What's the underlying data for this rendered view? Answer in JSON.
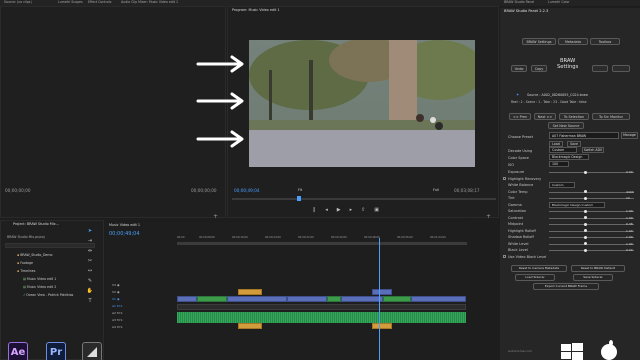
{
  "topbar": {
    "items": [
      "Source: (no clips)",
      "Lumetri Scopes",
      "Effect Controls",
      "Audio Clip Mixer: Music Video edit 1"
    ],
    "right": [
      "BRAW Studio Panel",
      "Lumetri Color"
    ]
  },
  "source": {
    "tc_left": "00;00;00;00",
    "tc_right": "00;00;00;00"
  },
  "program": {
    "tab": "Program: Music Video edit 1",
    "tc_left": "00;00;49;04",
    "fit": "Fit",
    "full": "Full",
    "tc_right": "00;03;08;17"
  },
  "braw": {
    "title": "BRAW Studio Panel 2.2.3",
    "tabs": [
      "BRAW Settings",
      "Metadata",
      "Toolbox"
    ],
    "toolbar": [
      "Undo",
      "Copy",
      "",
      ""
    ],
    "heading": "BRAW\nSettings",
    "source_line": "Source : A002_08260655_C024.braw",
    "meta_line": "Reel : 2 - Scene : 1 - Take : 23 - Good Take : false",
    "nav_buttons": [
      "<< Prev",
      "Next >>",
      "To Selection",
      "To Src Monitor"
    ],
    "set_source": "Set New Source",
    "preset_label": "Choose Preset",
    "preset_value": "A07 Fisherman BRAW",
    "manage": "Manage",
    "load": "Load",
    "save": "Save",
    "decode_label": "Decode Using",
    "decode_value": "Custom",
    "switch_adv": "Switch ADV",
    "colorspace_label": "Color Space",
    "colorspace_value": "Blackmagic Design",
    "iso_label": "ISO",
    "iso_value": "100",
    "rows": [
      {
        "label": "Exposure",
        "value": "0.00"
      },
      {
        "label": "Highlight Recovery",
        "value": ""
      },
      {
        "label": "White Balance",
        "value": "Custom"
      },
      {
        "label": "Color Temp",
        "value": "4400"
      },
      {
        "label": "Tint",
        "value": "10"
      },
      {
        "label": "Gamma",
        "value": "Blackmagic Design Custom"
      },
      {
        "label": "Saturation",
        "value": "1.00"
      },
      {
        "label": "Contrast",
        "value": "1.00"
      },
      {
        "label": "Midpoint",
        "value": "0.38"
      },
      {
        "label": "Highlight Rolloff",
        "value": "1.00"
      },
      {
        "label": "Shadow Rolloff",
        "value": "1.00"
      },
      {
        "label": "White Level",
        "value": "1.00"
      },
      {
        "label": "Black Level",
        "value": "0.00"
      },
      {
        "label": "Use Video Black Level",
        "value": ""
      }
    ],
    "bottom_buttons": [
      "Reset to Camera Metadata",
      "Reset to BRAW Default",
      "Load Sidecar",
      "Save Sidecar",
      "Export Current BRAW Frame"
    ],
    "footer": "Autokroma.com"
  },
  "project": {
    "tab": "Project: BRAW Studio Mix...",
    "path": "BRAW Studio Mix.prproj",
    "items": [
      "BRAW_Studio_Demo",
      "Footage",
      "Timelines",
      "Music Video edit 1",
      "Music Video edit 2",
      "Ocean View - Patrick Patrikios"
    ]
  },
  "timeline": {
    "tab": "Music Video edit 1",
    "tc": "00;00;49;04",
    "ruler": [
      "00;00",
      "00;00;08;00",
      "00;00;16;00",
      "00;00;24;00",
      "00;00;32;00",
      "00;00;40;00",
      "00;00;48;00",
      "00;00;56;00",
      "00;01;04;00",
      "00;01;12;00"
    ],
    "tracks": [
      "V3",
      "V2",
      "V1",
      "A1",
      "A2",
      "A3",
      "A4"
    ]
  },
  "apps": [
    "Ae",
    "Pr",
    ""
  ],
  "colors": {
    "accent": "#4a9eff",
    "video_clip": "#5b6fb8",
    "green_clip": "#3c9c4a",
    "orange_clip": "#d29b3c"
  }
}
